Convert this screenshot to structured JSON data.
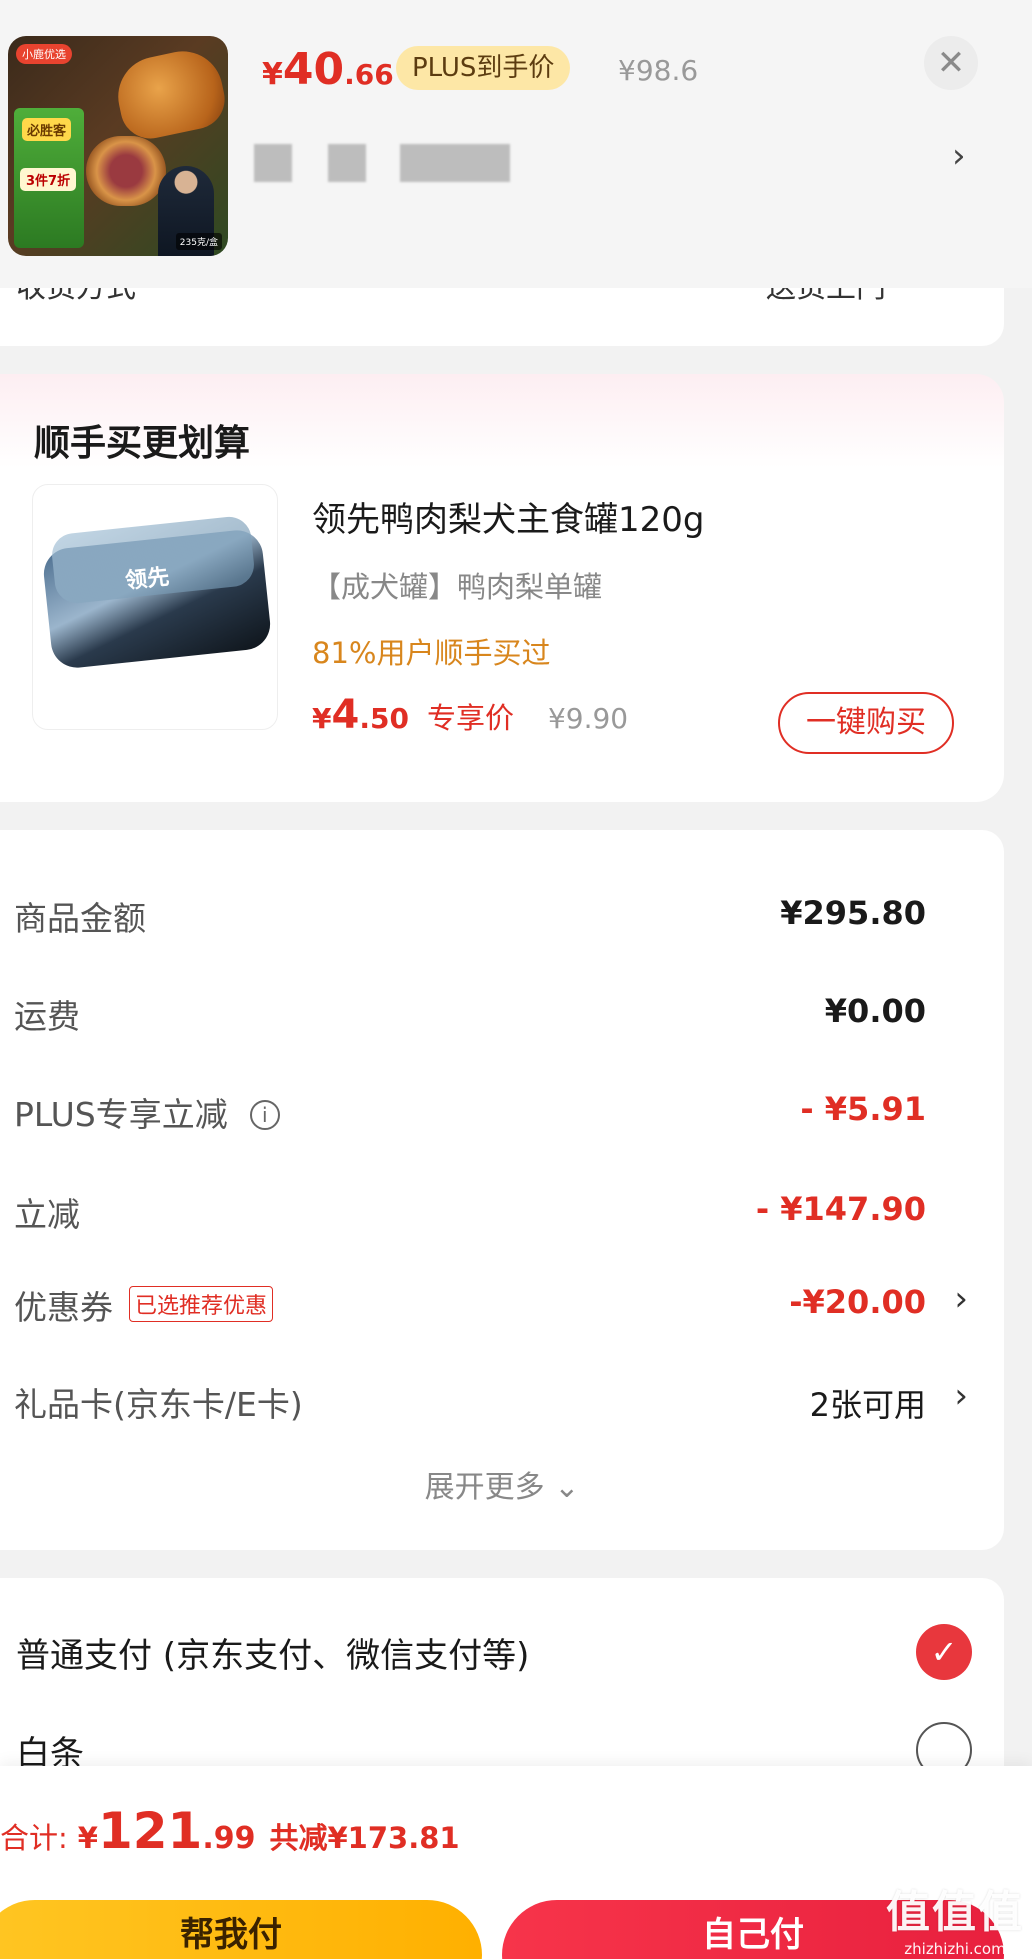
{
  "header": {
    "price_currency": "¥",
    "price_int": "40",
    "price_dec": ".66",
    "plus_label": "PLUS到手价",
    "original_price": "¥98.6",
    "close_icon": "close-icon",
    "chevron_icon": "chevron-right-icon",
    "thumb_badge": "小鹿优选",
    "thumb_tag1": "必胜客",
    "thumb_tag2": "3件7折",
    "thumb_sales": "235克/盒"
  },
  "partial": {
    "left": "收货方式",
    "right": "送货上门"
  },
  "recommend": {
    "title": "顺手买更划算",
    "can_label": "领先",
    "name": "领先鸭肉梨犬主食罐120g",
    "spec": "【成犬罐】鸭肉梨单罐",
    "hint": "81%用户顺手买过",
    "price_currency": "¥",
    "price_int": "4",
    "price_dec": ".50",
    "price_tag": "专享价",
    "original_price": "¥9.90",
    "buy_label": "一键购买"
  },
  "amounts": {
    "rows": [
      {
        "label": "商品金额",
        "value": "¥295.80"
      },
      {
        "label": "运费",
        "value": "¥0.00"
      },
      {
        "label": "PLUS专享立减",
        "value": "- ¥5.91"
      },
      {
        "label": "立减",
        "value": "- ¥147.90"
      },
      {
        "label": "优惠券",
        "tag": "已选推荐优惠",
        "value": "-¥20.00"
      },
      {
        "label": "礼品卡(京东卡/E卡)",
        "value": "2张可用"
      }
    ],
    "more_label": "展开更多 ⌄"
  },
  "payment": {
    "options": [
      {
        "label": "普通支付 (京东支付、微信支付等)",
        "selected": true
      },
      {
        "label": "白条",
        "selected": false
      }
    ]
  },
  "checkout": {
    "total_label": "合计:",
    "total_currency": "¥",
    "total_int": "121",
    "total_dec": ".99",
    "saved": "共减¥173.81",
    "help_pay": "帮我付",
    "self_pay": "自己付"
  },
  "watermark": {
    "logo": "值值值",
    "url": "zhizhizhi.com"
  },
  "colors": {
    "accent": "#e02e24",
    "plus_bg": "#fde7a6",
    "help_btn": "#ffb000"
  }
}
